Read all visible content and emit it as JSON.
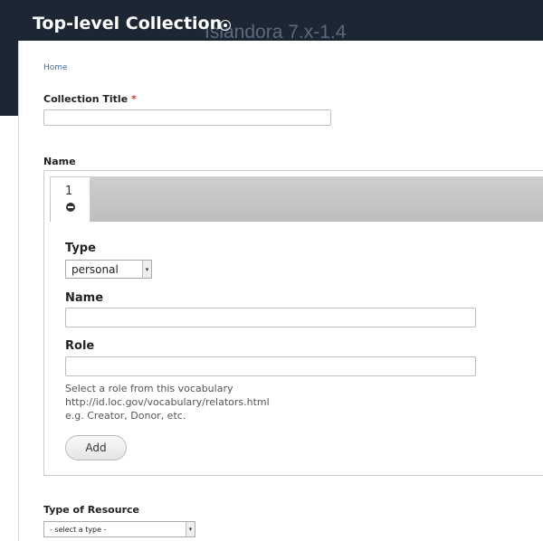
{
  "background": {
    "site_name": "Islandora 7.x-1.4"
  },
  "overlay": {
    "title": "Top-level Collection",
    "close_icon": "close-circle-icon"
  },
  "breadcrumb": {
    "home": "Home"
  },
  "form": {
    "collection_title": {
      "label": "Collection Title",
      "required_marker": "*",
      "value": ""
    },
    "name_section": {
      "label": "Name",
      "tabs": [
        {
          "label": "1",
          "remove_icon": "remove-circle-icon"
        }
      ],
      "type": {
        "label": "Type",
        "selected": "personal"
      },
      "name": {
        "label": "Name",
        "value": ""
      },
      "role": {
        "label": "Role",
        "value": "",
        "help_line1": "Select a role from this vocabulary",
        "help_line2": "http://id.loc.gov/vocabulary/relators.html",
        "help_line3": "e.g. Creator, Donor, etc."
      },
      "add_label": "Add"
    },
    "type_of_resource": {
      "label": "Type of Resource",
      "selected": "- select a type -"
    }
  },
  "colors": {
    "header_bg": "#1d2733",
    "link": "#3b6ea8",
    "required": "#dd3333"
  }
}
